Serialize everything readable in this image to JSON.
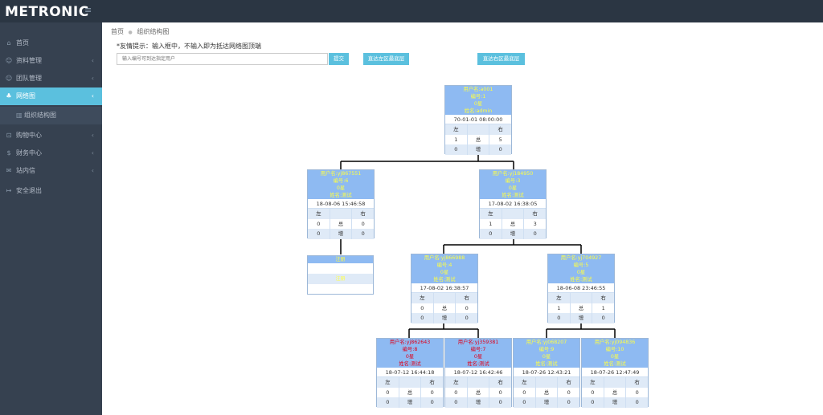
{
  "header": {
    "logo": "METRONIC",
    "menu_icon": "hamburger-icon"
  },
  "sidebar": {
    "items": [
      {
        "icon": "home-icon",
        "glyph": "⌂",
        "label": "首页",
        "arrow": ""
      },
      {
        "icon": "user-icon",
        "glyph": "☺",
        "label": "资料管理",
        "arrow": "‹"
      },
      {
        "icon": "users-icon",
        "glyph": "☺",
        "label": "团队管理",
        "arrow": "‹"
      },
      {
        "icon": "sitemap-icon",
        "glyph": "♣",
        "label": "网络图",
        "arrow": "‹"
      },
      {
        "icon": "cart-icon",
        "glyph": "⊡",
        "label": "购物中心",
        "arrow": "‹"
      },
      {
        "icon": "dollar-icon",
        "glyph": "$",
        "label": "财务中心",
        "arrow": "‹"
      },
      {
        "icon": "mail-icon",
        "glyph": "✉",
        "label": "站内信",
        "arrow": "‹"
      },
      {
        "icon": "logout-icon",
        "glyph": "↦",
        "label": "安全退出",
        "arrow": ""
      }
    ],
    "sub_item": {
      "icon": "bar-chart-icon",
      "glyph": "▥",
      "label": "组织结构图"
    }
  },
  "breadcrumb": {
    "home": "首页",
    "separator": "●",
    "current": "组织结构图"
  },
  "tip": "*友情提示：输入框中，不输入即为抵达网络图顶端",
  "search": {
    "placeholder": "输入编号可到达指定用户",
    "value": ""
  },
  "buttons": {
    "submit": "提交",
    "left_bottom": "直达左区最底层",
    "right_bottom": "直达右区最底层"
  },
  "labels": {
    "left": "左",
    "right": "右",
    "total": "总",
    "new": "增"
  },
  "register": {
    "title": "注册",
    "link": "注册"
  },
  "nodes": [
    {
      "user": "用户名:a001",
      "id": "编号:1",
      "level": "0星",
      "name": "姓名:admin",
      "date": "70-01-01 08:00:00",
      "left_total": "1",
      "right_total": "5",
      "left_new": "0",
      "right_new": "0",
      "color": "yellow"
    },
    {
      "user": "用户名:yj867551",
      "id": "编号:6",
      "level": "0星",
      "name": "姓名:测试",
      "date": "18-08-06 15:46:58",
      "left_total": "0",
      "right_total": "0",
      "left_new": "0",
      "right_new": "0",
      "color": "yellow"
    },
    {
      "user": "用户名:yj184950",
      "id": "编号:3",
      "level": "0星",
      "name": "姓名:测试",
      "date": "17-08-02 16:38:05",
      "left_total": "1",
      "right_total": "3",
      "left_new": "0",
      "right_new": "0",
      "color": "yellow"
    },
    {
      "user": "用户名:yj866988",
      "id": "编号:4",
      "level": "0星",
      "name": "姓名:测试",
      "date": "17-08-02 16:38:57",
      "left_total": "0",
      "right_total": "0",
      "left_new": "0",
      "right_new": "0",
      "color": "yellow"
    },
    {
      "user": "用户名:yj704927",
      "id": "编号:5",
      "level": "0星",
      "name": "姓名:测试",
      "date": "18-06-08 23:46:55",
      "left_total": "1",
      "right_total": "1",
      "left_new": "0",
      "right_new": "0",
      "color": "yellow"
    },
    {
      "user": "用户名:yj862643",
      "id": "编号:8",
      "level": "0星",
      "name": "姓名:测试",
      "date": "18-07-12 16:44:18",
      "left_total": "0",
      "right_total": "0",
      "left_new": "0",
      "right_new": "0",
      "color": "red"
    },
    {
      "user": "用户名:yj359381",
      "id": "编号:7",
      "level": "0星",
      "name": "姓名:测试",
      "date": "18-07-12 16:42:46",
      "left_total": "0",
      "right_total": "0",
      "left_new": "0",
      "right_new": "0",
      "color": "red"
    },
    {
      "user": "用户名:yj068207",
      "id": "编号:9",
      "level": "0星",
      "name": "姓名:测试",
      "date": "18-07-26 12:43:21",
      "left_total": "0",
      "right_total": "0",
      "left_new": "0",
      "right_new": "0",
      "color": "yellow"
    },
    {
      "user": "用户名:yj094836",
      "id": "编号:10",
      "level": "0星",
      "name": "姓名:测试",
      "date": "18-07-26 12:47:49",
      "left_total": "0",
      "right_total": "0",
      "left_new": "0",
      "right_new": "0",
      "color": "yellow"
    }
  ]
}
